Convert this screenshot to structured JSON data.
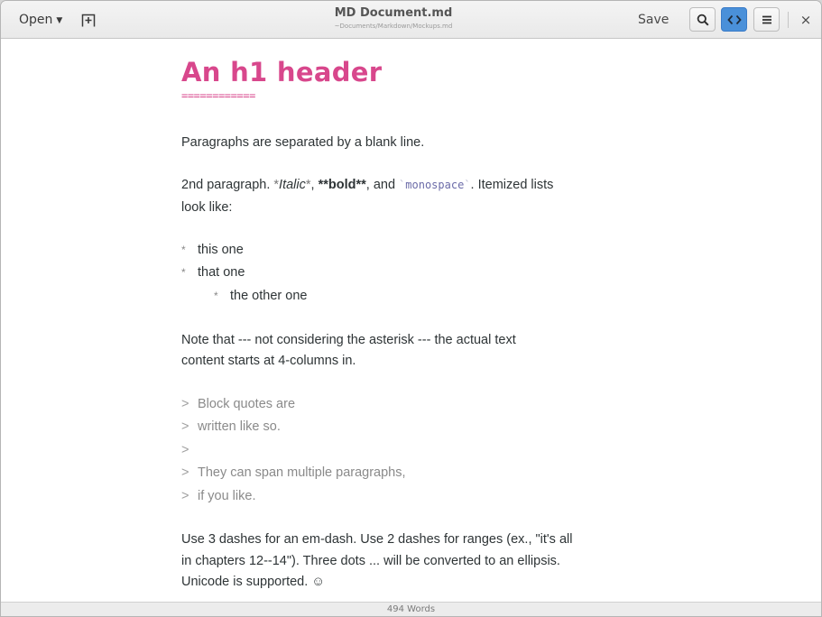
{
  "header": {
    "open_label": "Open",
    "title": "MD Document.md",
    "subtitle": "~Documents/Markdown/Mockups.md",
    "save_label": "Save",
    "close_glyph": "×"
  },
  "icons": {
    "open_caret": "chevron-down-icon",
    "new_tab": "new-tab-icon",
    "search": "search-icon",
    "preview": "code-icon",
    "menu": "hamburger-menu-icon",
    "close": "close-icon"
  },
  "colors": {
    "heading": "#d8478c",
    "accent": "#4a90d9"
  },
  "document": {
    "h1": "An h1 header",
    "h1_underline": "============",
    "p1": "Paragraphs are separated by a blank line.",
    "p2_a": "2nd paragraph. ",
    "p2_italic_open": "*",
    "p2_italic": "Italic",
    "p2_italic_close": "*",
    "p2_comma1": ", ",
    "p2_bold": "**bold**",
    "p2_and": ", and ",
    "p2_tick_open": "`",
    "p2_mono": "monospace",
    "p2_tick_close": "`",
    "p2_rest": ". Itemized lists",
    "p2_line2": "look like:",
    "list_marker": "*",
    "list": [
      "this one",
      "that one",
      "the other one"
    ],
    "note_line1": "Note that --- not considering the asterisk --- the actual text",
    "note_line2": "content starts at 4-columns in.",
    "quote_marker": ">",
    "quotes": [
      "Block quotes are",
      "written like so.",
      "",
      "They can span multiple paragraphs,",
      "if you like."
    ],
    "final_line1": "Use 3 dashes for an em-dash. Use 2 dashes for ranges (ex., \"it's all",
    "final_line2": "in chapters 12--14\"). Three dots ... will be converted to an ellipsis.",
    "final_line3": "Unicode is supported. ☺"
  },
  "status": {
    "word_count": "494 Words"
  }
}
